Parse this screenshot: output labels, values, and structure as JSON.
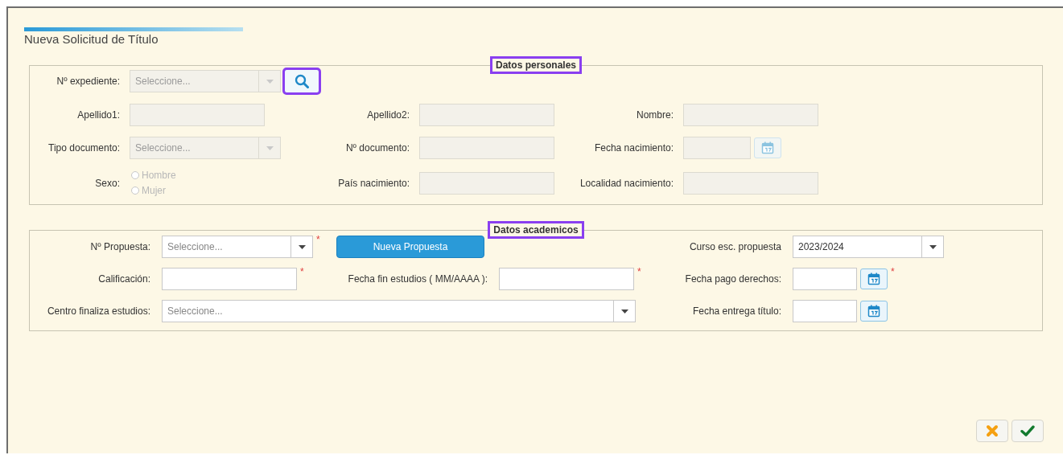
{
  "window": {
    "title": "Nueva Solicitud de Título"
  },
  "datos_personales": {
    "legend": "Datos personales",
    "legend_highlighted": true,
    "disabled": true,
    "expediente": {
      "label": "Nº expediente:",
      "placeholder": "Seleccione...",
      "search_highlighted": true
    },
    "apellido1": {
      "label": "Apellido1:"
    },
    "apellido2": {
      "label": "Apellido2:"
    },
    "nombre": {
      "label": "Nombre:"
    },
    "tipo_documento": {
      "label": "Tipo documento:",
      "placeholder": "Seleccione..."
    },
    "n_documento": {
      "label": "Nº documento:"
    },
    "fecha_nacimiento": {
      "label": "Fecha nacimiento:"
    },
    "sexo": {
      "label": "Sexo:",
      "options": [
        {
          "label": "Hombre",
          "selected": false
        },
        {
          "label": "Mujer",
          "selected": false
        }
      ]
    },
    "pais_nacimiento": {
      "label": "País nacimiento:"
    },
    "localidad_nacimiento": {
      "label": "Localidad nacimiento:"
    }
  },
  "datos_academicos": {
    "legend": "Datos academicos",
    "legend_highlighted": true,
    "disabled": false,
    "propuesta": {
      "label": "Nº Propuesta:",
      "placeholder": "Seleccione...",
      "required_mark": "*"
    },
    "nueva_propuesta_button": "Nueva Propuesta",
    "curso": {
      "label": "Curso esc. propuesta",
      "value": "2023/2024"
    },
    "calificacion": {
      "label": "Calificación:",
      "required_mark": "*"
    },
    "fecha_fin": {
      "label": "Fecha fin estudios ( MM/AAAA ):",
      "required_mark": "*"
    },
    "fecha_pago": {
      "label": "Fecha pago derechos:",
      "required_mark": "*"
    },
    "centro": {
      "label": "Centro finaliza estudios:",
      "placeholder": "Seleccione..."
    },
    "fecha_entrega": {
      "label": "Fecha entrega título:"
    }
  }
}
